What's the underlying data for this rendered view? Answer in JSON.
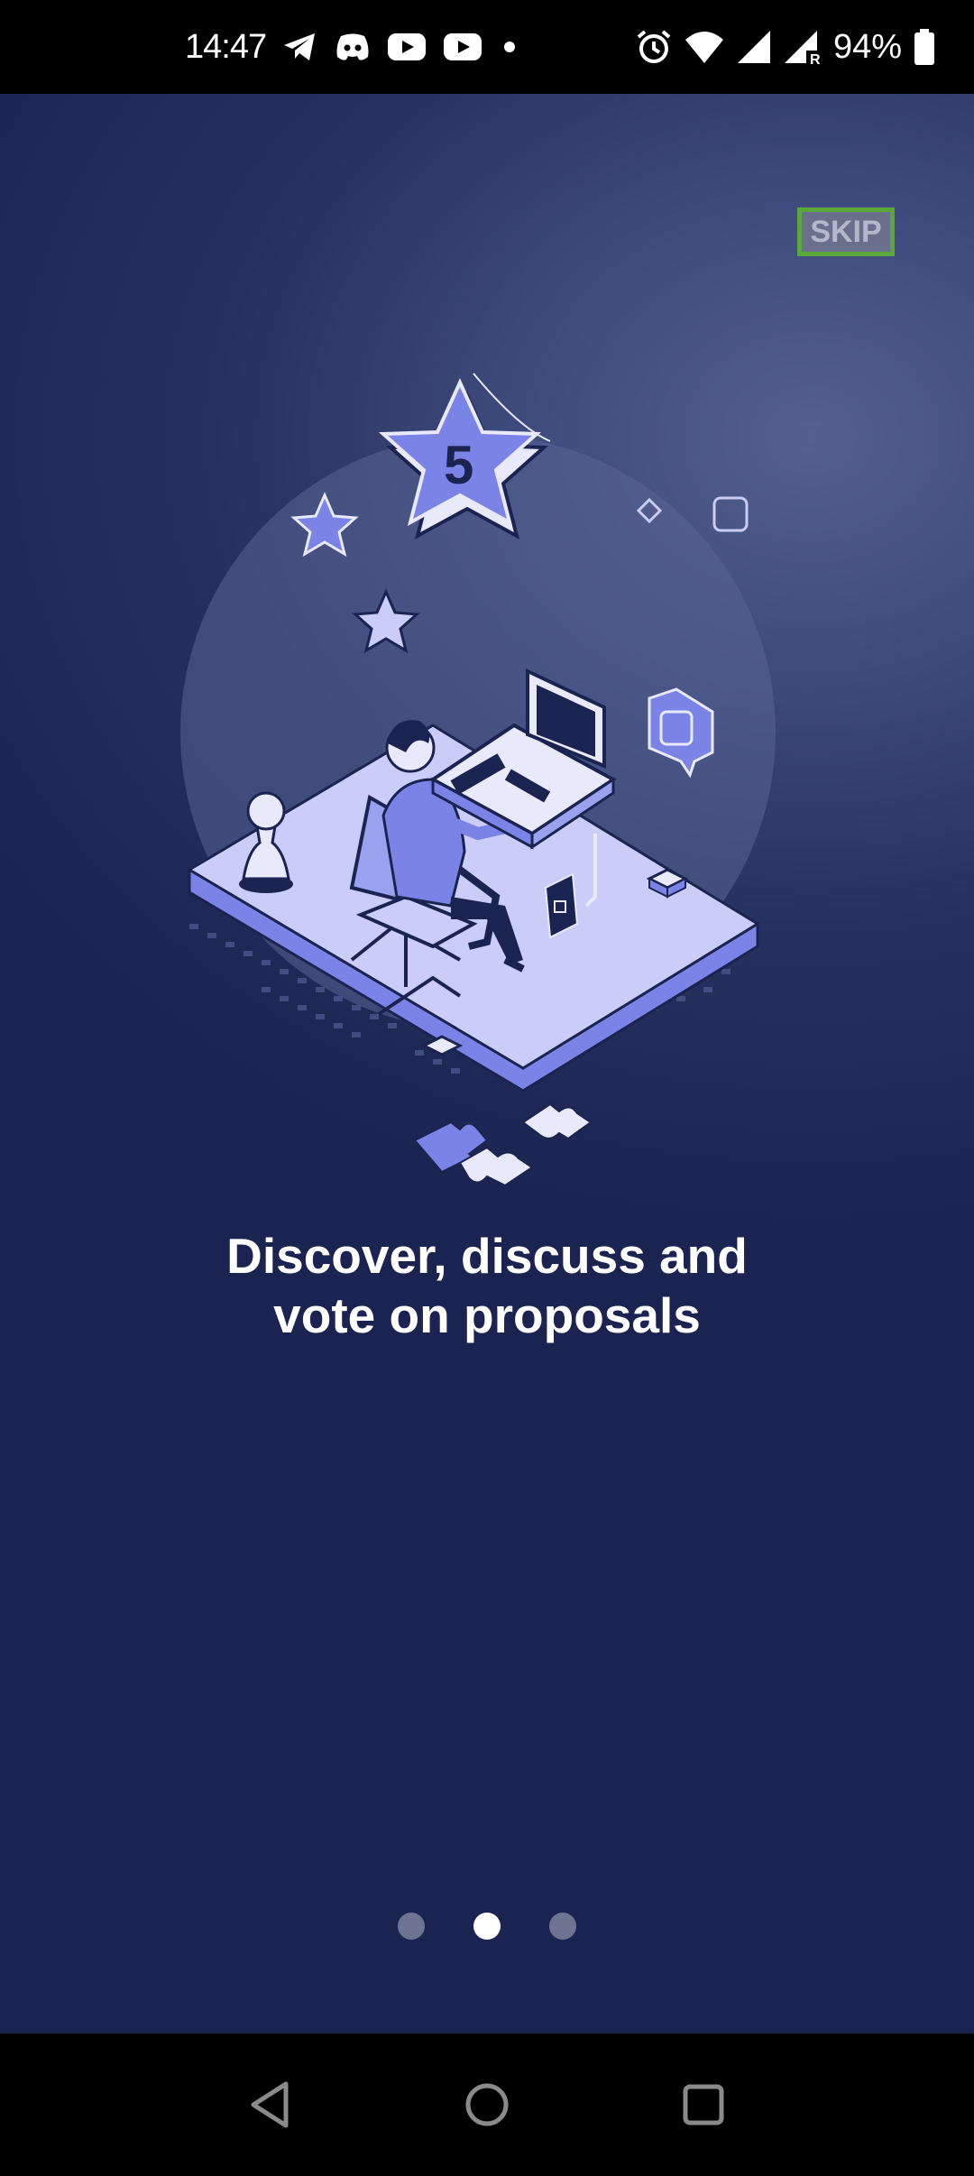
{
  "status_bar": {
    "time": "14:47",
    "battery_percent": "94%",
    "left_icons": [
      "telegram-icon",
      "discord-icon",
      "youtube-icon",
      "youtube-icon",
      "dot-icon"
    ],
    "right_icons": [
      "alarm-icon",
      "wifi-icon",
      "signal-icon",
      "signal-roaming-icon",
      "battery-icon"
    ]
  },
  "onboarding": {
    "skip_label": "SKIP",
    "headline_line1": "Discover, discuss and",
    "headline_line2": "vote on proposals",
    "star_badge_number": "5",
    "pages": 3,
    "current_page": 2
  },
  "nav_bar": {
    "buttons": [
      "back-icon",
      "home-icon",
      "recents-icon"
    ]
  },
  "colors": {
    "background_dark": "#1b2450",
    "background_light": "#55608f",
    "accent_periwinkle": "#7b84e6",
    "skip_border": "#5ba83a",
    "dot_inactive": "#6d7491",
    "dot_active": "#ffffff"
  }
}
